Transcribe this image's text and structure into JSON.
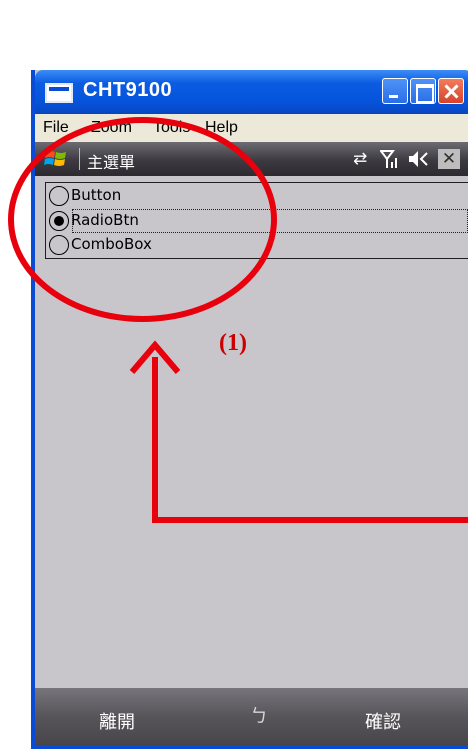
{
  "window": {
    "title": "CHT9100"
  },
  "menubar": {
    "items": [
      "File",
      "Zoom",
      "Tools",
      "Help"
    ]
  },
  "device_header": {
    "title": "主選單",
    "icons": [
      "windows-flag-icon",
      "connectivity-icon",
      "signal-icon",
      "volume-icon",
      "close-icon"
    ],
    "close_glyph": "✕"
  },
  "radios": [
    {
      "label": "Button",
      "checked": false
    },
    {
      "label": "RadioBtn",
      "checked": true
    },
    {
      "label": "ComboBox",
      "checked": false
    }
  ],
  "annotation": {
    "label": "(1)",
    "color": "#e8000c"
  },
  "softkeys": {
    "left": "離開",
    "right": "確認",
    "sip_glyph": "ㄅ"
  },
  "colors": {
    "titlebar": "#0654dc",
    "device_bg": "#c8c6cb",
    "header_bg": "#3c3a40"
  }
}
